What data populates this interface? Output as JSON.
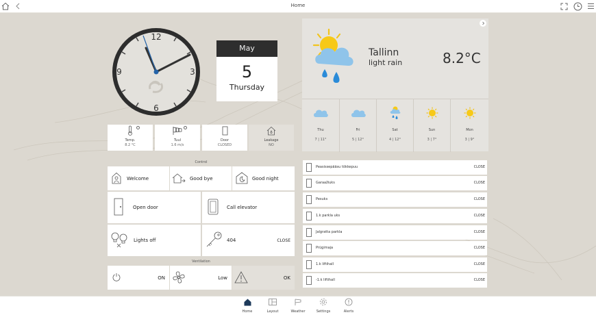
{
  "topbar": {
    "title": "Home",
    "icons": [
      "home-icon",
      "back-icon",
      "fullscreen-icon",
      "history-clock-icon",
      "menu-icon"
    ]
  },
  "clock": {
    "numbers": [
      "12",
      "3",
      "6",
      "9"
    ],
    "hour": 12,
    "minute": 58
  },
  "calendar": {
    "month": "May",
    "day": "5",
    "weekday": "Thursday"
  },
  "sensors": [
    {
      "icon": "thermometer-icon",
      "label": "Temp.",
      "value": "8.2 °C"
    },
    {
      "icon": "windsock-icon",
      "label": "Tuul",
      "value": "1.6 m/s"
    },
    {
      "icon": "door-icon",
      "label": "Door",
      "value": "CLOSED"
    },
    {
      "icon": "leak-house-icon",
      "label": "Leakage",
      "value": "NO"
    }
  ],
  "control": {
    "title": "Control",
    "scenes": [
      {
        "icon": "person-home-icon",
        "label": "Welcome"
      },
      {
        "icon": "house-leave-icon",
        "label": "Good bye"
      },
      {
        "icon": "moon-icon",
        "label": "Good night"
      }
    ],
    "open_door": "Open door",
    "call_elevator": "Call elevator",
    "lights": {
      "label": "Lights off"
    },
    "apartment": {
      "label": "404",
      "status": "CLOSE"
    }
  },
  "ventilation": {
    "title": "Ventilation",
    "power_status": "ON",
    "fan_level": "Low",
    "alarm_status": "OK"
  },
  "weather": {
    "city": "Tallinn",
    "condition": "light rain",
    "temp": "8.2°C",
    "forecast": [
      {
        "day": "Thu",
        "temps": "7 | 11°",
        "icon": "cloud-icon"
      },
      {
        "day": "Fri",
        "temps": "5 | 12°",
        "icon": "cloud-icon"
      },
      {
        "day": "Sat",
        "temps": "4 | 12°",
        "icon": "sun-cloud-rain-icon"
      },
      {
        "day": "Sun",
        "temps": "3 | 7°",
        "icon": "sun-icon"
      },
      {
        "day": "Mon",
        "temps": "3 | 9°",
        "icon": "sun-icon"
      }
    ]
  },
  "doors": [
    {
      "name": "Peasissepääsu tõkkepuu",
      "status": "CLOSE"
    },
    {
      "name": "Garaažiuks",
      "status": "CLOSE"
    },
    {
      "name": "Pesuks",
      "status": "CLOSE"
    },
    {
      "name": "1.k parkla uks",
      "status": "CLOSE"
    },
    {
      "name": "Jalgratta parkla",
      "status": "CLOSE"
    },
    {
      "name": "Prügimaja",
      "status": "CLOSE"
    },
    {
      "name": "1.k liftihall",
      "status": "CLOSE"
    },
    {
      "name": "-1.k liftihall",
      "status": "CLOSE"
    }
  ],
  "nav": [
    {
      "label": "Home",
      "icon": "home-icon"
    },
    {
      "label": "Layout",
      "icon": "layout-icon"
    },
    {
      "label": "Weather",
      "icon": "weather-icon"
    },
    {
      "label": "Settings",
      "icon": "gear-icon"
    },
    {
      "label": "Alerts",
      "icon": "alert-icon"
    }
  ]
}
